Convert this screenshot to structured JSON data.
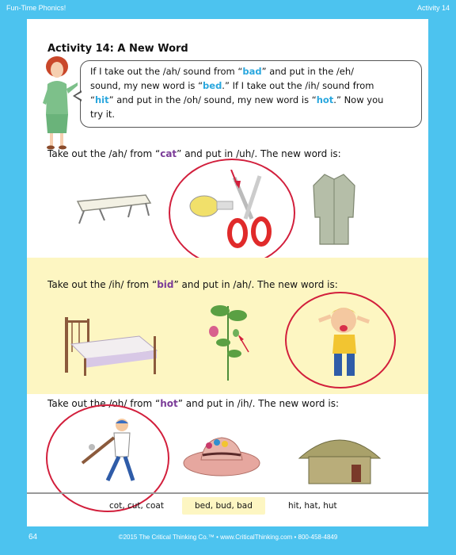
{
  "header": {
    "book_title": "Fun-Time Phonics!",
    "activity_label": "Activity 14"
  },
  "title": "Activity 14:  A New Word",
  "intro": {
    "line1_a": "If I take out the /ah/ sound from “",
    "line1_kw": "bad",
    "line1_b": "” and put in the /eh/",
    "line2_a": "sound, my new word is “",
    "line2_kw": "bed",
    "line2_b": ".”  If I take out the /ih/ sound from",
    "line3_a": "“",
    "line3_kw": "hit",
    "line3_b": "” and put in the /oh/ sound, my new word is “",
    "line3_kw2": "hot",
    "line3_c": ".”  Now you",
    "line4": "try it."
  },
  "questions": [
    {
      "a": "Take out the /ah/ from “",
      "kw": "cat",
      "b": "” and put in /uh/.  The new word is:"
    },
    {
      "a": "Take out the /ih/ from “",
      "kw": "bid",
      "b": "” and put in /ah/.  The new word is:"
    },
    {
      "a": "Take out the /oh/ from “",
      "kw": "hot",
      "b": "” and put in /ih/.  The new word is:"
    }
  ],
  "answers": [
    "cot, cut, coat",
    "bed, bud, bad",
    "hit, hat, hut"
  ],
  "footer": {
    "page": "64",
    "copyright": "©2015 The Critical Thinking Co.™ • www.CriticalThinking.com • 800-458-4849"
  },
  "colors": {
    "border": "#4cc3ef",
    "keyword": "#2aa7de",
    "circle": "#d21f3c",
    "highlight": "#fdf6c2"
  }
}
